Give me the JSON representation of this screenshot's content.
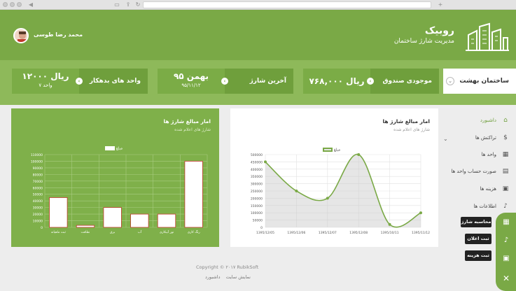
{
  "colors": {
    "primary": "#7aa946",
    "dark": "#6f9f3c",
    "light": "#8eb95a",
    "line": "#7aa946"
  },
  "user": {
    "name": "محمد رضا طوسی"
  },
  "brand": {
    "name": "روبیک",
    "subtitle": "مدیریت شارژ ساختمان"
  },
  "building": {
    "selected": "ساختمان بهشت"
  },
  "stats": {
    "fund": {
      "label": "موجودی صندوق",
      "value": "۷۶۸,۰۰۰ ریال"
    },
    "last_charge": {
      "label": "آخرین شارژ",
      "value": "بهمن ۹۵",
      "sub": "۹۵/۱۱/۱۲"
    },
    "debtors": {
      "label": "واحد های بدهکار",
      "value": "۱۲۰۰۰ ریال",
      "sub": "۷ واحد"
    }
  },
  "sidebar": {
    "items": [
      {
        "label": "داشبورد",
        "icon": "dashboard-icon",
        "glyph": "⌂"
      },
      {
        "label": "تراکنش ها",
        "icon": "money-bag-icon",
        "glyph": "$"
      },
      {
        "label": "واحد ها",
        "icon": "building-icon",
        "glyph": "▦"
      },
      {
        "label": "صورت حساب واحد ها",
        "icon": "invoice-icon",
        "glyph": "▤"
      },
      {
        "label": "هزینه ها",
        "icon": "calendar-icon",
        "glyph": "▣"
      },
      {
        "label": "اطلاعات ها",
        "icon": "bell-icon",
        "glyph": "♪"
      }
    ]
  },
  "actions": {
    "charge_calc": "محاسبه شارژ",
    "add_notice": "ثبت اعلان",
    "add_expense": "ثبت هزینه"
  },
  "chart_data": [
    {
      "type": "bar",
      "title": "امار مبالغ شارژ ها",
      "subtitle": "شارژ های اعلام شده",
      "categories": [
        "ثبت ماهیانه",
        "نظافت",
        "برق",
        "آب",
        "نور آبیکاری",
        "رنگ کاری"
      ],
      "series": [
        {
          "name": "مبلغ",
          "values": [
            45000,
            3000,
            30000,
            20000,
            20000,
            100000
          ]
        }
      ],
      "ylim": [
        0,
        110000
      ],
      "ytick_labels": [
        "110000",
        "100000",
        "90000",
        "80000",
        "70000",
        "60000",
        "50000",
        "40000",
        "30000",
        "20000",
        "10000",
        "0"
      ],
      "grid": true,
      "legend": "top-center"
    },
    {
      "type": "line",
      "title": "امار مبالغ شارژ ها",
      "subtitle": "شارژ های اعلام شده",
      "categories": [
        "1395/12/05",
        "1395/12/06",
        "1395/12/07",
        "1395/12/08",
        "1395/10/11",
        "1395/11/12"
      ],
      "series": [
        {
          "name": "مبلغ",
          "values": [
            450000,
            250000,
            200000,
            500000,
            20000,
            100000
          ]
        }
      ],
      "ylim": [
        0,
        500000
      ],
      "ytick_labels": [
        "500000",
        "450000",
        "400000",
        "350000",
        "300000",
        "250000",
        "200000",
        "150000",
        "100000",
        "50000",
        "0"
      ],
      "grid": true,
      "legend": "top-center"
    }
  ],
  "footer": {
    "copyright": "Copyright © ۲۰۱۷ RubikSoft",
    "link_site": "نمایش سایت",
    "link_dashboard": "داشبورد"
  }
}
